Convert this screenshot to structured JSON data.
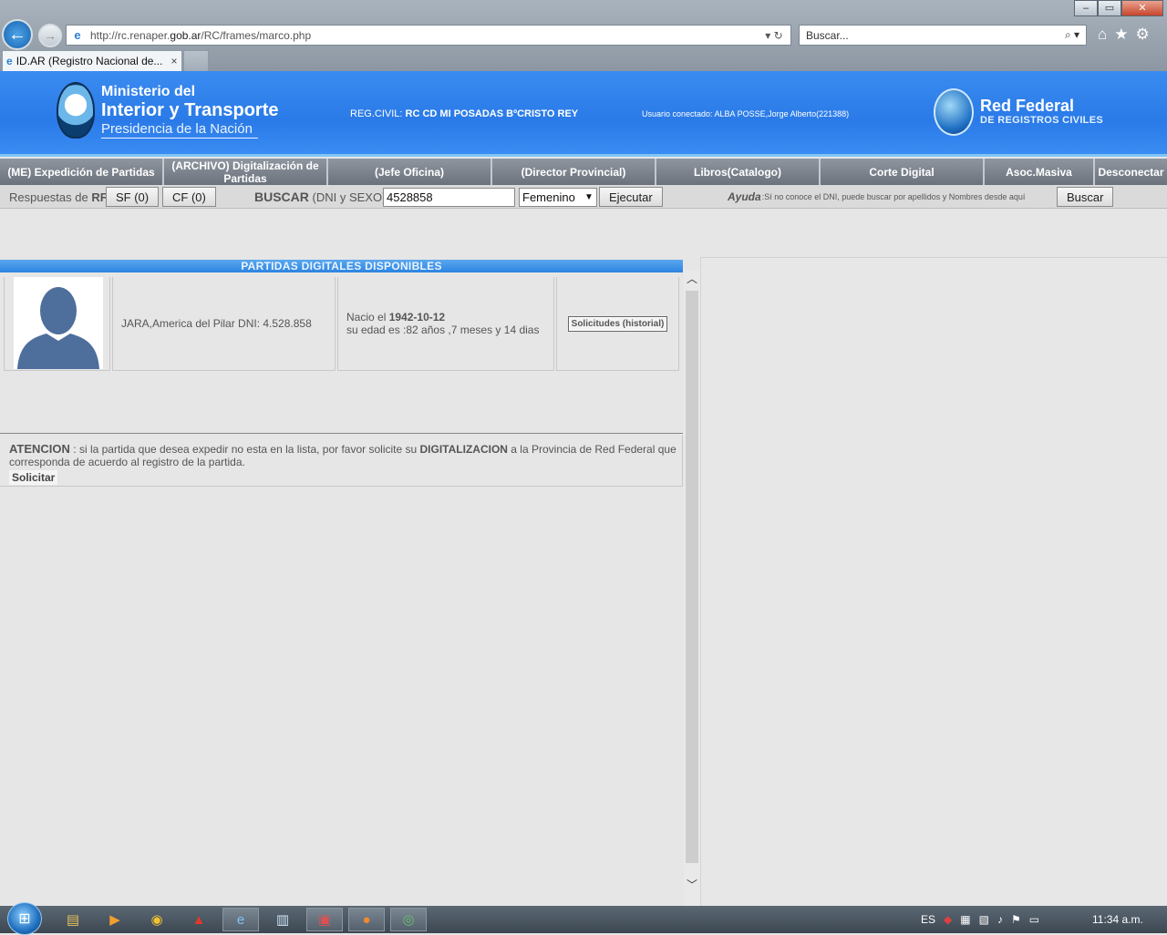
{
  "browser": {
    "url_prefix": "http://rc.renaper.",
    "url_domain": "gob.ar",
    "url_suffix": "/RC/frames/marco.php",
    "search_placeholder": "Buscar...",
    "tab_title": "ID.AR (Registro Nacional de...",
    "tab_close": "×",
    "win_minimize": "–",
    "win_restore": "▭",
    "win_close": "✕"
  },
  "header": {
    "ministry_line1": "Ministerio del",
    "ministry_line2": "Interior y Transporte",
    "ministry_line3": "Presidencia de la Nación",
    "reg_civil_label": "REG.CIVIL:",
    "reg_civil_value": "RC CD MI POSADAS BºCRISTO REY",
    "usuario": "Usuario conectado: ALBA POSSE,Jorge Alberto(221388)",
    "red_federal_l1": "Red Federal",
    "red_federal_l2": "DE REGISTROS CIVILES"
  },
  "menu": [
    {
      "label": "(ME) Expedición de Partidas"
    },
    {
      "label": "(ARCHIVO) Digitalización de Partidas"
    },
    {
      "label": "(Jefe Oficina)"
    },
    {
      "label": "(Director Provincial)"
    },
    {
      "label": "Libros(Catalogo)"
    },
    {
      "label": "Corte Digital"
    },
    {
      "label": "Asoc.Masiva"
    },
    {
      "label": "Desconectar"
    }
  ],
  "search": {
    "respuestas_label": "Respuestas de",
    "respuestas_rf": "RF",
    "sf_button": "SF (0)",
    "cf_button": "CF (0)",
    "buscar_label": "BUSCAR",
    "buscar_hint": "(DNI y SEXO)",
    "dni_value": "4528858",
    "sexo_selected": "Femenino",
    "ejecutar_button": "Ejecutar",
    "ayuda_label": "Ayuda",
    "ayuda_text": ":Sí no conoce el DNI, puede buscar por apellidos y Nombres desde aquí",
    "buscar_button": "Buscar"
  },
  "results": {
    "title": "PARTIDAS DIGITALES DISPONIBLES",
    "rows": [
      {
        "name_dni": "JARA,America del Pilar DNI: 4.528.858",
        "nacio_label": "Nacio el",
        "birth_date": "1942-10-12",
        "edad": "su edad es :82 años ,7 meses y 14 dias",
        "action": "Solicitudes (historial)"
      }
    ]
  },
  "atencion": {
    "label": "ATENCION",
    "text1": ": si la partida que desea expedir no esta en la lista, por favor solicite su",
    "bold": "DIGITALIZACION",
    "text2": "a la Provincia de Red Federal que corresponda de acuerdo al registro de la partida.",
    "solicitar": "Solicitar"
  },
  "taskbar": {
    "language": "ES",
    "clock": "11:34 a.m."
  },
  "colors": {
    "header_blue": "#2a7ae8",
    "menu_gray": "#7d848e",
    "title_blue": "#2d84e0"
  }
}
